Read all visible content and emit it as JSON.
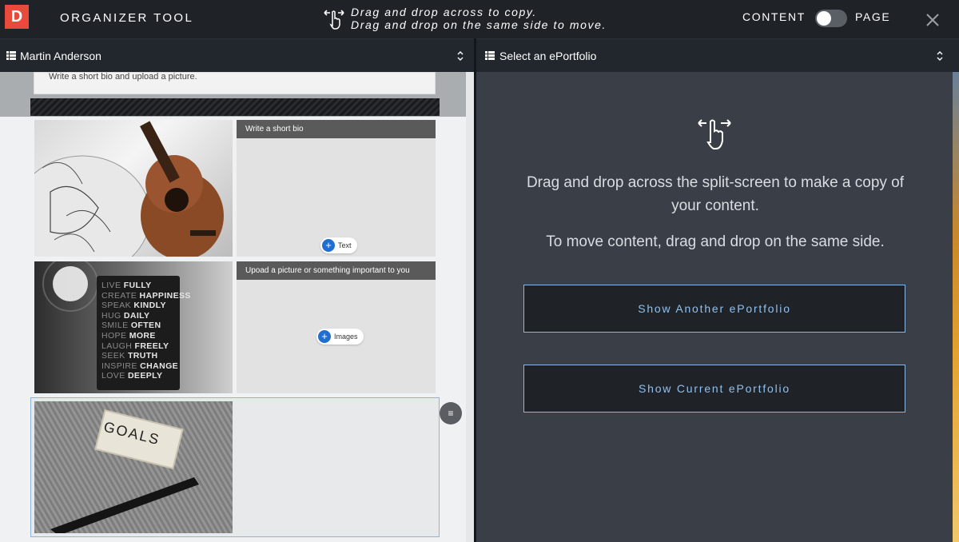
{
  "header": {
    "logo_letter": "D",
    "title": "ORGANIZER TOOL",
    "hint_line1": "Drag and drop across to copy.",
    "hint_line2": "Drag and drop on the same side to move.",
    "mode_left_label": "CONTENT",
    "mode_right_label": "PAGE",
    "mode_toggle_on": false
  },
  "left_selector": {
    "label": "Martin Anderson"
  },
  "right_selector": {
    "label": "Select an ePortfolio"
  },
  "left_pane": {
    "bio_hint": "Write a short bio and upload a picture.",
    "cards": [
      {
        "header": "Write a short bio",
        "chip_label": "Text"
      },
      {
        "header": "Upoad a picture or something important to you",
        "chip_label": "Images"
      }
    ],
    "sign_lines": [
      [
        "LIVE",
        "FULLY"
      ],
      [
        "CREATE",
        "HAPPINESS"
      ],
      [
        "SPEAK",
        "KINDLY"
      ],
      [
        "HUG",
        "DAILY"
      ],
      [
        "SMILE",
        "OFTEN"
      ],
      [
        "HOPE",
        "MORE"
      ],
      [
        "LAUGH",
        "FREELY"
      ],
      [
        "SEEK",
        "TRUTH"
      ],
      [
        "INSPIRE",
        "CHANGE"
      ],
      [
        "LOVE",
        "DEEPLY"
      ]
    ],
    "goals_label": "GOALS"
  },
  "right_pane": {
    "message_copy": "Drag and drop across the split-screen to make a copy of your content.",
    "message_move": "To move content, drag and drop on the same side.",
    "btn_another": "Show Another ePortfolio",
    "btn_current": "Show Current ePortfolio"
  },
  "colors": {
    "brand_red": "#e84a3b",
    "accent_blue": "#1f6fd1",
    "button_border": "#8fb6e0"
  }
}
